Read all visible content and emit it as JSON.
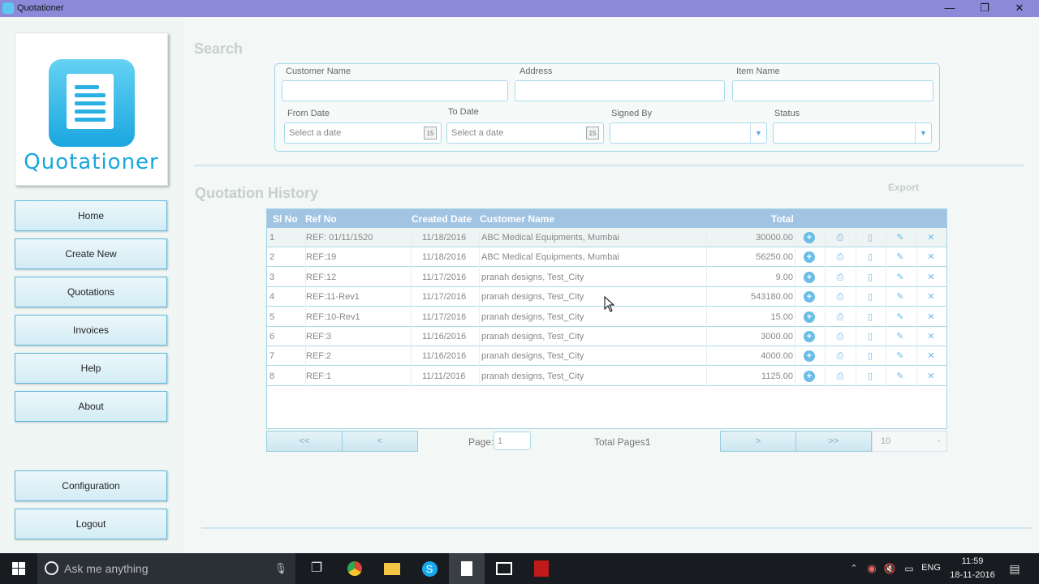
{
  "window": {
    "title": "Quotationer",
    "minimize": "—",
    "maximize": "❐",
    "close": "✕"
  },
  "logo": {
    "text": "Quotationer"
  },
  "sidebar": {
    "items": [
      {
        "label": "Home"
      },
      {
        "label": "Create New"
      },
      {
        "label": "Quotations"
      },
      {
        "label": "Invoices"
      },
      {
        "label": "Help"
      },
      {
        "label": "About"
      }
    ],
    "bottom": [
      {
        "label": "Configuration"
      },
      {
        "label": "Logout"
      }
    ]
  },
  "search": {
    "title": "Search",
    "customer_name_label": "Customer Name",
    "address_label": "Address",
    "item_name_label": "Item Name",
    "from_date_label": "From Date",
    "to_date_label": "To Date",
    "signed_by_label": "Signed By",
    "status_label": "Status",
    "from_date_placeholder": "Select a date",
    "to_date_placeholder": "Select a date",
    "calendar_day": "15"
  },
  "history": {
    "title": "Quotation History",
    "export_label": "Export",
    "columns": [
      "Sl No",
      "Ref No",
      "Created Date",
      "Customer Name",
      "Total"
    ],
    "rows": [
      {
        "sl": "1",
        "ref": "REF: 01/11/1520",
        "date": "11/18/2016",
        "customer": "ABC Medical Equipments, Mumbai",
        "total": "30000.00"
      },
      {
        "sl": "2",
        "ref": "REF:19",
        "date": "11/18/2016",
        "customer": "ABC Medical Equipments, Mumbai",
        "total": "56250.00"
      },
      {
        "sl": "3",
        "ref": "REF:12",
        "date": "11/17/2016",
        "customer": "pranah designs, Test_City",
        "total": "9.00"
      },
      {
        "sl": "4",
        "ref": "REF:11-Rev1",
        "date": "11/17/2016",
        "customer": "pranah designs, Test_City",
        "total": "543180.00"
      },
      {
        "sl": "5",
        "ref": "REF:10-Rev1",
        "date": "11/17/2016",
        "customer": "pranah designs, Test_City",
        "total": "15.00"
      },
      {
        "sl": "6",
        "ref": "REF:3",
        "date": "11/16/2016",
        "customer": "pranah designs, Test_City",
        "total": "3000.00"
      },
      {
        "sl": "7",
        "ref": "REF:2",
        "date": "11/16/2016",
        "customer": "pranah designs, Test_City",
        "total": "4000.00"
      },
      {
        "sl": "8",
        "ref": "REF:1",
        "date": "11/11/2016",
        "customer": "pranah designs, Test_City",
        "total": "1125.00"
      }
    ],
    "row_actions": [
      "add-icon",
      "print-icon",
      "document-icon",
      "edit-icon",
      "delete-icon"
    ]
  },
  "pager": {
    "first": "<<",
    "prev": "<",
    "next": ">",
    "last": ">>",
    "page_label": "Page:",
    "page_value": "1",
    "total_pages_label": "Total Pages:",
    "total_pages": "1",
    "page_size": "10"
  },
  "taskbar": {
    "search_placeholder": "Ask me anything",
    "language": "ENG",
    "time": "11:59",
    "date": "18-11-2016"
  }
}
